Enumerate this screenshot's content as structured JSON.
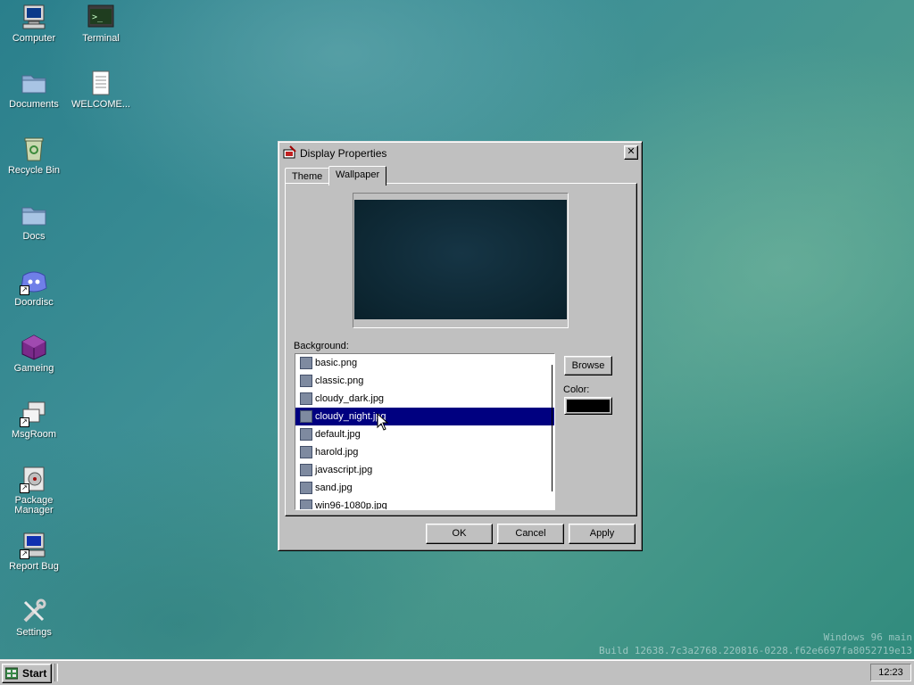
{
  "desktop": {
    "icons": [
      {
        "label": "Computer"
      },
      {
        "label": "Terminal"
      },
      {
        "label": "Documents"
      },
      {
        "label": "WELCOME..."
      },
      {
        "label": "Recycle Bin"
      },
      {
        "label": "Docs"
      },
      {
        "label": "Doordisc"
      },
      {
        "label": "Gameing"
      },
      {
        "label": "MsgRoom"
      },
      {
        "label": "Package Manager"
      },
      {
        "label": "Report Bug"
      },
      {
        "label": "Settings"
      }
    ],
    "build_line1": "Windows 96 main",
    "build_line2": "Build 12638.7c3a2768.220816-0228.f62e6697fa8052719e13"
  },
  "window": {
    "title": "Display Properties",
    "close_glyph": "✕",
    "tabs": [
      {
        "label": "Theme",
        "active": false
      },
      {
        "label": "Wallpaper",
        "active": true
      }
    ],
    "background_label": "Background:",
    "files": [
      {
        "name": "basic.png"
      },
      {
        "name": "classic.png"
      },
      {
        "name": "cloudy_dark.jpg"
      },
      {
        "name": "cloudy_night.jpg",
        "selected": true
      },
      {
        "name": "default.jpg"
      },
      {
        "name": "harold.jpg"
      },
      {
        "name": "javascript.jpg"
      },
      {
        "name": "sand.jpg"
      },
      {
        "name": "win96-1080p.jpg"
      }
    ],
    "browse_label": "Browse",
    "color_label": "Color:",
    "color_value": "#000000",
    "ok_label": "OK",
    "cancel_label": "Cancel",
    "apply_label": "Apply"
  },
  "taskbar": {
    "start_label": "Start",
    "clock": "12:23"
  }
}
